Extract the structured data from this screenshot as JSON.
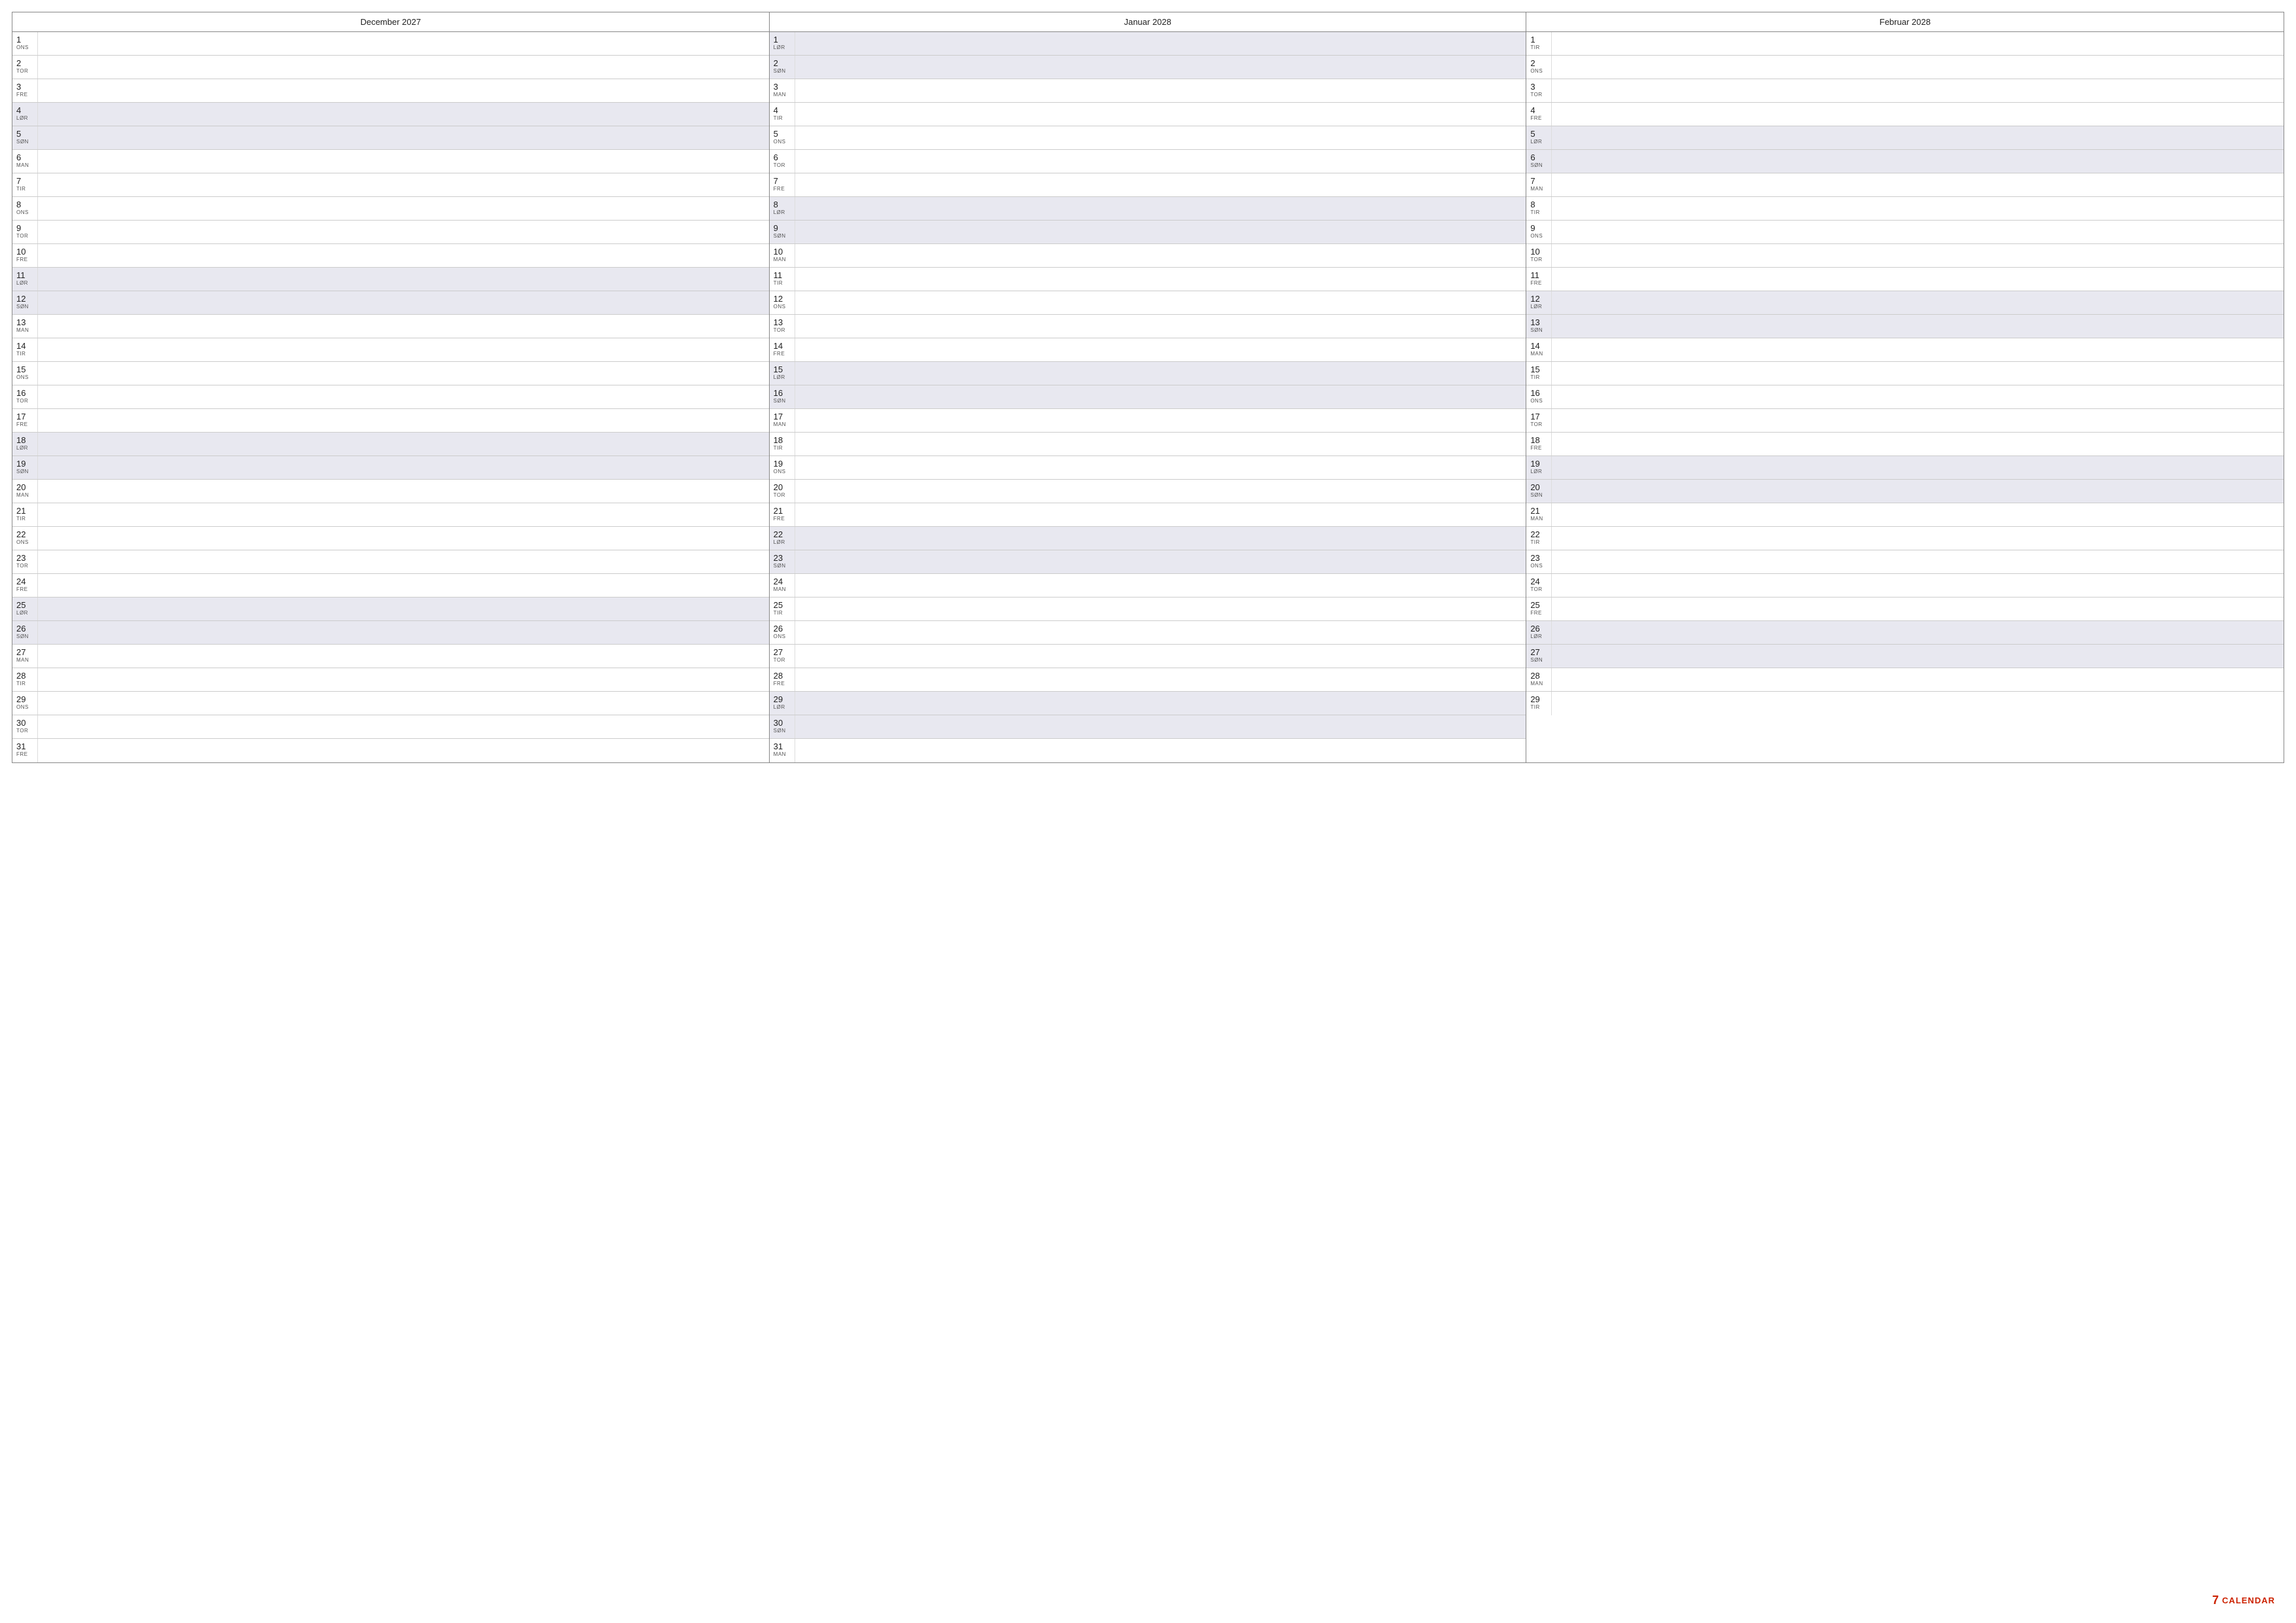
{
  "months": [
    {
      "name": "December 2027",
      "days": [
        {
          "num": "1",
          "name": "ONS",
          "weekend": false
        },
        {
          "num": "2",
          "name": "TOR",
          "weekend": false
        },
        {
          "num": "3",
          "name": "FRE",
          "weekend": false
        },
        {
          "num": "4",
          "name": "LØR",
          "weekend": true
        },
        {
          "num": "5",
          "name": "SØN",
          "weekend": true
        },
        {
          "num": "6",
          "name": "MAN",
          "weekend": false
        },
        {
          "num": "7",
          "name": "TIR",
          "weekend": false
        },
        {
          "num": "8",
          "name": "ONS",
          "weekend": false
        },
        {
          "num": "9",
          "name": "TOR",
          "weekend": false
        },
        {
          "num": "10",
          "name": "FRE",
          "weekend": false
        },
        {
          "num": "11",
          "name": "LØR",
          "weekend": true
        },
        {
          "num": "12",
          "name": "SØN",
          "weekend": true
        },
        {
          "num": "13",
          "name": "MAN",
          "weekend": false
        },
        {
          "num": "14",
          "name": "TIR",
          "weekend": false
        },
        {
          "num": "15",
          "name": "ONS",
          "weekend": false
        },
        {
          "num": "16",
          "name": "TOR",
          "weekend": false
        },
        {
          "num": "17",
          "name": "FRE",
          "weekend": false
        },
        {
          "num": "18",
          "name": "LØR",
          "weekend": true
        },
        {
          "num": "19",
          "name": "SØN",
          "weekend": true
        },
        {
          "num": "20",
          "name": "MAN",
          "weekend": false
        },
        {
          "num": "21",
          "name": "TIR",
          "weekend": false
        },
        {
          "num": "22",
          "name": "ONS",
          "weekend": false
        },
        {
          "num": "23",
          "name": "TOR",
          "weekend": false
        },
        {
          "num": "24",
          "name": "FRE",
          "weekend": false
        },
        {
          "num": "25",
          "name": "LØR",
          "weekend": true
        },
        {
          "num": "26",
          "name": "SØN",
          "weekend": true
        },
        {
          "num": "27",
          "name": "MAN",
          "weekend": false
        },
        {
          "num": "28",
          "name": "TIR",
          "weekend": false
        },
        {
          "num": "29",
          "name": "ONS",
          "weekend": false
        },
        {
          "num": "30",
          "name": "TOR",
          "weekend": false
        },
        {
          "num": "31",
          "name": "FRE",
          "weekend": false
        }
      ]
    },
    {
      "name": "Januar 2028",
      "days": [
        {
          "num": "1",
          "name": "LØR",
          "weekend": true
        },
        {
          "num": "2",
          "name": "SØN",
          "weekend": true
        },
        {
          "num": "3",
          "name": "MAN",
          "weekend": false
        },
        {
          "num": "4",
          "name": "TIR",
          "weekend": false
        },
        {
          "num": "5",
          "name": "ONS",
          "weekend": false
        },
        {
          "num": "6",
          "name": "TOR",
          "weekend": false
        },
        {
          "num": "7",
          "name": "FRE",
          "weekend": false
        },
        {
          "num": "8",
          "name": "LØR",
          "weekend": true
        },
        {
          "num": "9",
          "name": "SØN",
          "weekend": true
        },
        {
          "num": "10",
          "name": "MAN",
          "weekend": false
        },
        {
          "num": "11",
          "name": "TIR",
          "weekend": false
        },
        {
          "num": "12",
          "name": "ONS",
          "weekend": false
        },
        {
          "num": "13",
          "name": "TOR",
          "weekend": false
        },
        {
          "num": "14",
          "name": "FRE",
          "weekend": false
        },
        {
          "num": "15",
          "name": "LØR",
          "weekend": true
        },
        {
          "num": "16",
          "name": "SØN",
          "weekend": true
        },
        {
          "num": "17",
          "name": "MAN",
          "weekend": false
        },
        {
          "num": "18",
          "name": "TIR",
          "weekend": false
        },
        {
          "num": "19",
          "name": "ONS",
          "weekend": false
        },
        {
          "num": "20",
          "name": "TOR",
          "weekend": false
        },
        {
          "num": "21",
          "name": "FRE",
          "weekend": false
        },
        {
          "num": "22",
          "name": "LØR",
          "weekend": true
        },
        {
          "num": "23",
          "name": "SØN",
          "weekend": true
        },
        {
          "num": "24",
          "name": "MAN",
          "weekend": false
        },
        {
          "num": "25",
          "name": "TIR",
          "weekend": false
        },
        {
          "num": "26",
          "name": "ONS",
          "weekend": false
        },
        {
          "num": "27",
          "name": "TOR",
          "weekend": false
        },
        {
          "num": "28",
          "name": "FRE",
          "weekend": false
        },
        {
          "num": "29",
          "name": "LØR",
          "weekend": true
        },
        {
          "num": "30",
          "name": "SØN",
          "weekend": true
        },
        {
          "num": "31",
          "name": "MAN",
          "weekend": false
        }
      ]
    },
    {
      "name": "Februar 2028",
      "days": [
        {
          "num": "1",
          "name": "TIR",
          "weekend": false
        },
        {
          "num": "2",
          "name": "ONS",
          "weekend": false
        },
        {
          "num": "3",
          "name": "TOR",
          "weekend": false
        },
        {
          "num": "4",
          "name": "FRE",
          "weekend": false
        },
        {
          "num": "5",
          "name": "LØR",
          "weekend": true
        },
        {
          "num": "6",
          "name": "SØN",
          "weekend": true
        },
        {
          "num": "7",
          "name": "MAN",
          "weekend": false
        },
        {
          "num": "8",
          "name": "TIR",
          "weekend": false
        },
        {
          "num": "9",
          "name": "ONS",
          "weekend": false
        },
        {
          "num": "10",
          "name": "TOR",
          "weekend": false
        },
        {
          "num": "11",
          "name": "FRE",
          "weekend": false
        },
        {
          "num": "12",
          "name": "LØR",
          "weekend": true
        },
        {
          "num": "13",
          "name": "SØN",
          "weekend": true
        },
        {
          "num": "14",
          "name": "MAN",
          "weekend": false
        },
        {
          "num": "15",
          "name": "TIR",
          "weekend": false
        },
        {
          "num": "16",
          "name": "ONS",
          "weekend": false
        },
        {
          "num": "17",
          "name": "TOR",
          "weekend": false
        },
        {
          "num": "18",
          "name": "FRE",
          "weekend": false
        },
        {
          "num": "19",
          "name": "LØR",
          "weekend": true
        },
        {
          "num": "20",
          "name": "SØN",
          "weekend": true
        },
        {
          "num": "21",
          "name": "MAN",
          "weekend": false
        },
        {
          "num": "22",
          "name": "TIR",
          "weekend": false
        },
        {
          "num": "23",
          "name": "ONS",
          "weekend": false
        },
        {
          "num": "24",
          "name": "TOR",
          "weekend": false
        },
        {
          "num": "25",
          "name": "FRE",
          "weekend": false
        },
        {
          "num": "26",
          "name": "LØR",
          "weekend": true
        },
        {
          "num": "27",
          "name": "SØN",
          "weekend": true
        },
        {
          "num": "28",
          "name": "MAN",
          "weekend": false
        },
        {
          "num": "29",
          "name": "TIR",
          "weekend": false
        }
      ]
    }
  ],
  "branding": {
    "icon": "7",
    "label": "CALENDAR"
  }
}
